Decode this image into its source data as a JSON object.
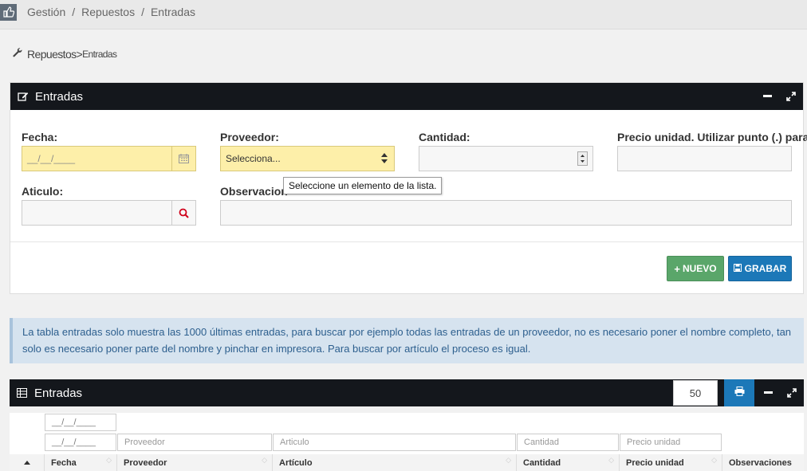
{
  "topbar": {
    "home_icon": "thumbs-up-icon",
    "crumbs": [
      "Gestión",
      "Repuestos",
      "Entradas"
    ],
    "separator": "/"
  },
  "page_heading": {
    "icon": "wrench-icon",
    "main": "Repuestos",
    "chevron": ">",
    "sub": "Entradas"
  },
  "form_widget": {
    "title": "Entradas",
    "fecha_label": "Fecha:",
    "fecha_placeholder": "__/__/____",
    "proveedor_label": "Proveedor:",
    "proveedor_value": "Selecciona...",
    "cantidad_label": "Cantidad:",
    "precio_label": "Precio unidad. Utilizar punto (.) para d",
    "articulo_label": "Aticulo:",
    "observaciones_label": "Observacion",
    "tooltip": "Seleccione un elemento de la lista.",
    "nuevo_label": "NUEVO",
    "grabar_label": "GRABAR"
  },
  "info_text": "La tabla entradas solo muestra las 1000 últimas entradas, para buscar por ejemplo todas las entradas de un proveedor, no es necesario poner el nombre completo, tan solo es necesario poner parte del nombre y pinchar en impresora. Para buscar por artículo el proceso es igual.",
  "table_widget": {
    "title": "Entradas",
    "page_size": "50",
    "filters": {
      "fecha_from": "__/__/____",
      "fecha_to": "__/__/____",
      "proveedor": "Proveedor",
      "articulo": "Articulo",
      "cantidad": "Cantidad",
      "precio": "Precio unidad"
    },
    "columns": [
      "Fecha",
      "Proveedor",
      "Artículo",
      "Cantidad",
      "Precio unidad",
      "Observaciones"
    ]
  },
  "colors": {
    "header_dark": "#14171c",
    "field_yellow": "#fdefa9",
    "btn_green": "#5aa66a",
    "btn_blue": "#1c78b8",
    "info_bg": "#d6e3ef"
  }
}
